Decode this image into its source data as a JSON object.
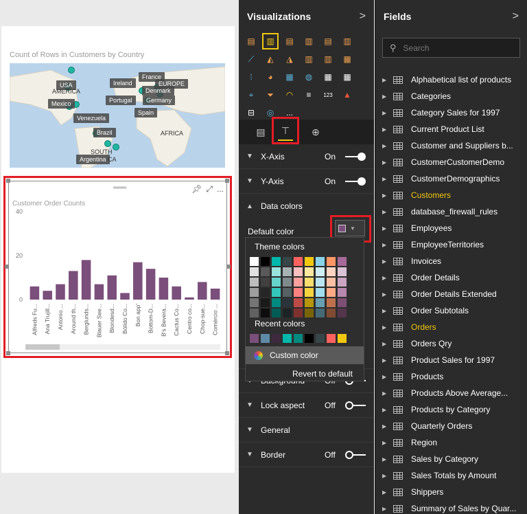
{
  "map": {
    "title": "Count of Rows in Customers by Country",
    "labels": [
      "USA",
      "France",
      "Ireland",
      "EUROPE",
      "Denmark",
      "Portugal",
      "Germany",
      "Mexico",
      "Spain",
      "Venezuela",
      "Brazil",
      "Argentina"
    ],
    "plain_labels": [
      "AMERICA",
      "AFRICA",
      "SOUTH",
      "CA"
    ]
  },
  "bar_chart": {
    "title": "Customer Order Counts",
    "toolbar": {
      "pin": "pin-icon",
      "focus": "focus-mode-icon",
      "more": "..."
    }
  },
  "chart_data": {
    "type": "bar",
    "title": "Customer Order Counts",
    "categories": [
      "Alfreds Fu...",
      "Ana Trujill...",
      "Antonio ...",
      "Around th...",
      "Berglunds...",
      "Blauer See...",
      "Blondesd...",
      "Bólido Co...",
      "Bon app'",
      "Bottom-D...",
      "B's Bevera...",
      "Cactus Co...",
      "Centro co...",
      "Chop-sue...",
      "Comércio ..."
    ],
    "values": [
      6,
      4,
      7,
      13,
      18,
      7,
      11,
      3,
      17,
      14,
      10,
      6,
      1,
      8,
      5
    ],
    "yticks": [
      "40",
      "20",
      "0"
    ],
    "ylim": [
      0,
      40
    ],
    "color": "#7b4f7b"
  },
  "viz_pane": {
    "title": "Visualizations",
    "chevron": ">",
    "sections": [
      {
        "label": "X-Axis",
        "state": "On"
      },
      {
        "label": "Y-Axis",
        "state": "On"
      },
      {
        "label": "Data colors",
        "state": ""
      },
      {
        "label": "Background",
        "state": "Off"
      },
      {
        "label": "Lock aspect",
        "state": "Off"
      },
      {
        "label": "General",
        "state": ""
      },
      {
        "label": "Border",
        "state": "Off"
      }
    ],
    "default_color_label": "Default color",
    "default_color": "#7b4f7b",
    "picker": {
      "theme_title": "Theme colors",
      "recent_title": "Recent colors",
      "custom_label": "Custom color",
      "revert_label": "Revert to default"
    },
    "more": "..."
  },
  "fields_pane": {
    "title": "Fields",
    "chevron": ">",
    "search_placeholder": "Search",
    "items": [
      {
        "name": "Alphabetical list of products",
        "highlight": false
      },
      {
        "name": "Categories",
        "highlight": false
      },
      {
        "name": "Category Sales for 1997",
        "highlight": false
      },
      {
        "name": "Current Product List",
        "highlight": false
      },
      {
        "name": "Customer and Suppliers b...",
        "highlight": false
      },
      {
        "name": "CustomerCustomerDemo",
        "highlight": false
      },
      {
        "name": "CustomerDemographics",
        "highlight": false
      },
      {
        "name": "Customers",
        "highlight": true
      },
      {
        "name": "database_firewall_rules",
        "highlight": false
      },
      {
        "name": "Employees",
        "highlight": false
      },
      {
        "name": "EmployeeTerritories",
        "highlight": false
      },
      {
        "name": "Invoices",
        "highlight": false
      },
      {
        "name": "Order Details",
        "highlight": false
      },
      {
        "name": "Order Details Extended",
        "highlight": false
      },
      {
        "name": "Order Subtotals",
        "highlight": false
      },
      {
        "name": "Orders",
        "highlight": true
      },
      {
        "name": "Orders Qry",
        "highlight": false
      },
      {
        "name": "Product Sales for 1997",
        "highlight": false
      },
      {
        "name": "Products",
        "highlight": false
      },
      {
        "name": "Products Above Average...",
        "highlight": false
      },
      {
        "name": "Products by Category",
        "highlight": false
      },
      {
        "name": "Quarterly Orders",
        "highlight": false
      },
      {
        "name": "Region",
        "highlight": false
      },
      {
        "name": "Sales by Category",
        "highlight": false
      },
      {
        "name": "Sales Totals by Amount",
        "highlight": false
      },
      {
        "name": "Shippers",
        "highlight": false
      },
      {
        "name": "Summary of Sales by Quar...",
        "highlight": false
      }
    ]
  },
  "colors": {
    "accent_yellow": "#f2c811",
    "highlight_red": "#e21d25",
    "pane_bg": "#2b2b2b"
  }
}
